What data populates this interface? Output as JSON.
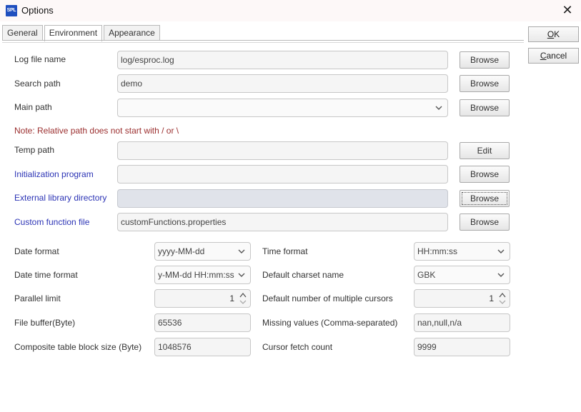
{
  "window": {
    "icon_text": "SPL",
    "title": "Options",
    "close_glyph": "✕"
  },
  "tabs": [
    {
      "label": "General"
    },
    {
      "label": "Environment"
    },
    {
      "label": "Appearance"
    }
  ],
  "active_tab": "Environment",
  "side_buttons": {
    "ok_mnemonic": "O",
    "ok_rest": "K",
    "cancel_mnemonic": "C",
    "cancel_rest": "ancel"
  },
  "paths": {
    "log_file": {
      "label": "Log file name",
      "value": "log/esproc.log",
      "button": "Browse"
    },
    "search_path": {
      "label": "Search path",
      "value": "demo",
      "button": "Browse"
    },
    "main_path": {
      "label": "Main path",
      "value": "",
      "button": "Browse"
    },
    "note": "Note: Relative path does not start with / or \\",
    "temp_path": {
      "label": "Temp path",
      "value": "",
      "button": "Edit"
    },
    "init_program": {
      "label": "Initialization program",
      "value": "",
      "button": "Browse"
    },
    "ext_lib_dir": {
      "label": "External library directory",
      "value": "",
      "button": "Browse"
    },
    "custom_func": {
      "label": "Custom function file",
      "value": "customFunctions.properties",
      "button": "Browse"
    }
  },
  "settings": {
    "date_format": {
      "label": "Date format",
      "value": "yyyy-MM-dd"
    },
    "time_format": {
      "label": "Time format",
      "value": "HH:mm:ss"
    },
    "datetime_format": {
      "label": "Date time format",
      "value": "y-MM-dd HH:mm:ss"
    },
    "charset": {
      "label": "Default charset name",
      "value": "GBK"
    },
    "parallel_limit": {
      "label": "Parallel limit",
      "value": "1"
    },
    "multi_cursors": {
      "label": "Default number of multiple cursors",
      "value": "1"
    },
    "file_buffer": {
      "label": "File buffer(Byte)",
      "value": "65536"
    },
    "missing_values": {
      "label": "Missing values (Comma-separated)",
      "value": "nan,null,n/a"
    },
    "block_size": {
      "label": "Composite table block size (Byte)",
      "value": "1048576"
    },
    "cursor_fetch": {
      "label": "Cursor fetch count",
      "value": "9999"
    }
  },
  "colors": {
    "label_blue": "#2b33b5",
    "note_red": "#9b2f2f",
    "disabled_field": "#e0e3ea"
  }
}
